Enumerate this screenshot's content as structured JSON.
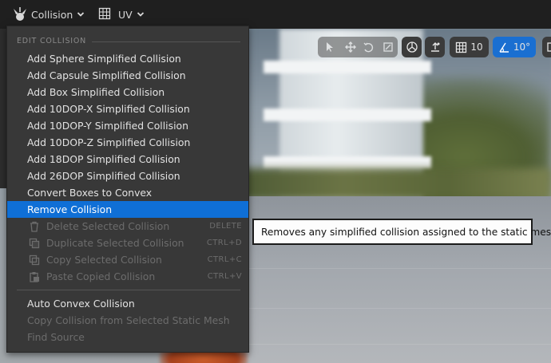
{
  "toolbar": {
    "collision_label": "Collision",
    "uv_label": "UV"
  },
  "viewport_tools": {
    "grid_snap_value": "10",
    "angle_snap_value": "10°"
  },
  "menu": {
    "header": "EDIT COLLISION",
    "items": [
      {
        "label": "Add Sphere Simplified Collision"
      },
      {
        "label": "Add Capsule Simplified Collision"
      },
      {
        "label": "Add Box Simplified Collision"
      },
      {
        "label": "Add 10DOP-X Simplified Collision"
      },
      {
        "label": "Add 10DOP-Y Simplified Collision"
      },
      {
        "label": "Add 10DOP-Z Simplified Collision"
      },
      {
        "label": "Add 18DOP Simplified Collision"
      },
      {
        "label": "Add 26DOP Simplified Collision"
      },
      {
        "label": "Convert Boxes to Convex"
      },
      {
        "label": "Remove Collision"
      }
    ],
    "disabled_items": [
      {
        "label": "Delete Selected Collision",
        "shortcut": "DELETE",
        "icon": "trash-icon"
      },
      {
        "label": "Duplicate Selected Collision",
        "shortcut": "CTRL+D",
        "icon": "duplicate-icon"
      },
      {
        "label": "Copy Selected Collision",
        "shortcut": "CTRL+C",
        "icon": "copy-icon"
      },
      {
        "label": "Paste Copied Collision",
        "shortcut": "CTRL+V",
        "icon": "paste-icon"
      }
    ],
    "bottom_items": [
      {
        "label": "Auto Convex Collision"
      },
      {
        "label": "Copy Collision from Selected Static Mesh"
      },
      {
        "label": "Find Source"
      }
    ]
  },
  "tooltip": {
    "text": "Removes any simplified collision assigned to the static mesh."
  },
  "colors": {
    "highlight": "#0f6fd6",
    "menu_bg": "#383838",
    "toolbar_bg": "#1f1f1f"
  }
}
